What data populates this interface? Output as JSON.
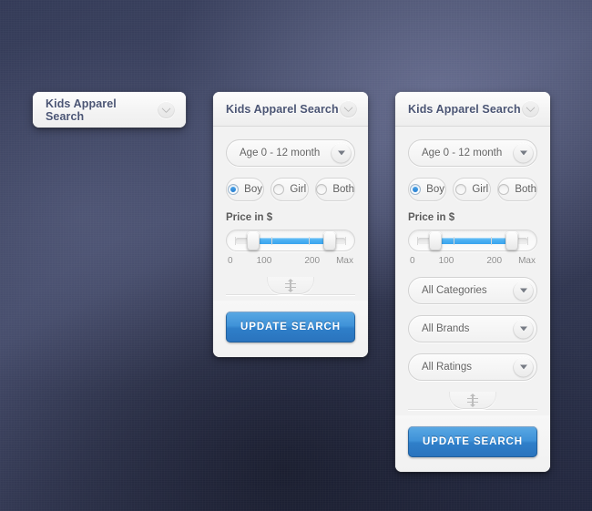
{
  "background": {
    "base_color": "#3b4160",
    "dark_color": "#232840",
    "light_color": "#5a607e"
  },
  "theme": {
    "accent_blue": "#3f92d8",
    "slider_fill": "#4aaff2",
    "title_color": "#4b5574",
    "panel_bg": "#f2f2f2"
  },
  "panels": {
    "collapsed": {
      "title": "Kids Apparel Search",
      "toggle_icon": "chevron-down-icon"
    },
    "medium": {
      "title": "Kids Apparel Search",
      "toggle_icon": "chevron-down-icon",
      "age_select": {
        "value": "Age 0 - 12 month",
        "icon": "caret-down-icon"
      },
      "gender": {
        "options": [
          {
            "label": "Boy",
            "selected": true
          },
          {
            "label": "Girl",
            "selected": false
          },
          {
            "label": "Both",
            "selected": false
          }
        ]
      },
      "price": {
        "title": "Price in $",
        "ticks": [
          "0",
          "100",
          "200",
          "Max"
        ],
        "min_percent": 16,
        "max_percent": 85
      },
      "resize_handle_icon": "vertical-resize-icon",
      "cta_label": "UPDATE SEARCH"
    },
    "large": {
      "title": "Kids Apparel Search",
      "toggle_icon": "chevron-down-icon",
      "age_select": {
        "value": "Age 0 - 12 month",
        "icon": "caret-down-icon"
      },
      "gender": {
        "options": [
          {
            "label": "Boy",
            "selected": true
          },
          {
            "label": "Girl",
            "selected": false
          },
          {
            "label": "Both",
            "selected": false
          }
        ]
      },
      "price": {
        "title": "Price in $",
        "ticks": [
          "0",
          "100",
          "200",
          "Max"
        ],
        "min_percent": 16,
        "max_percent": 85
      },
      "categories_select": {
        "value": "All Categories",
        "icon": "caret-down-icon"
      },
      "brands_select": {
        "value": "All Brands",
        "icon": "caret-down-icon"
      },
      "ratings_select": {
        "value": "All Ratings",
        "icon": "caret-down-icon"
      },
      "resize_handle_icon": "vertical-resize-icon",
      "cta_label": "UPDATE SEARCH"
    }
  }
}
